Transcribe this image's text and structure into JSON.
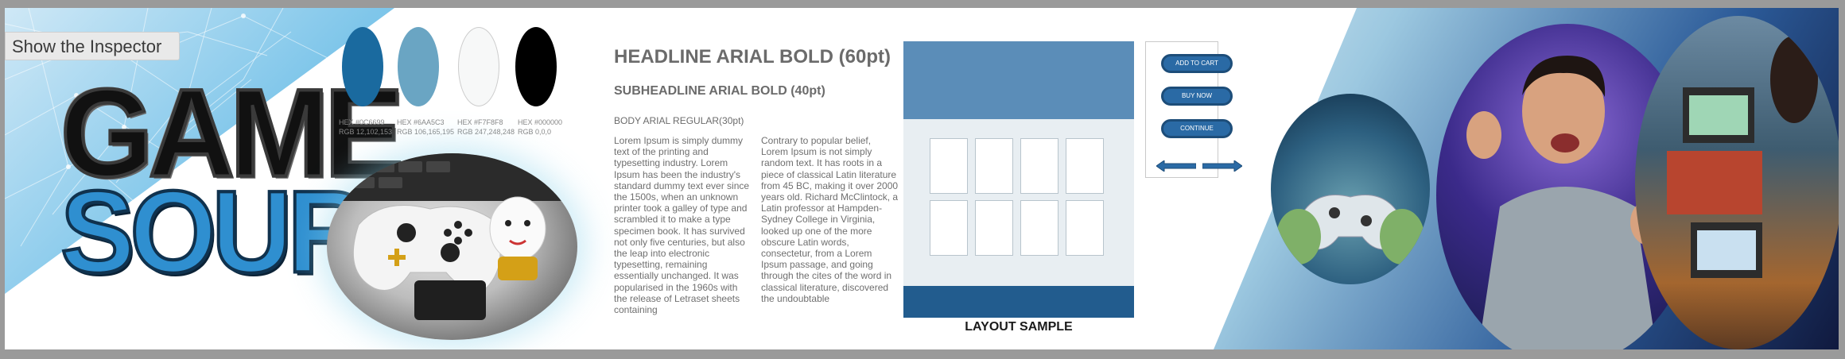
{
  "inspector": {
    "label": "Show the Inspector"
  },
  "logo": {
    "line1": "GAME",
    "line2": "SOURCE"
  },
  "swatches": [
    {
      "hex": "HEX #0C6699",
      "rgb": "RGB 12,102,153",
      "color": "#1a6a9f"
    },
    {
      "hex": "HEX #6AA5C3",
      "rgb": "RGB 106,165,195",
      "color": "#6aa5c3"
    },
    {
      "hex": "HEX #F7F8F8",
      "rgb": "RGB 247,248,248",
      "color": "#f7f8f8"
    },
    {
      "hex": "HEX #000000",
      "rgb": "RGB 0,0,0",
      "color": "#000000"
    }
  ],
  "typography": {
    "headline": "HEADLINE ARIAL BOLD (60pt)",
    "subheadline": "SUBHEADLINE ARIAL BOLD (40pt)",
    "body_title": "BODY ARIAL REGULAR(30pt)",
    "col1": "Lorem Ipsum is simply dummy text of the printing and typesetting industry. Lorem Ipsum has been the industry's standard dummy text ever since the 1500s, when an unknown printer took a galley of type and scrambled it to make a type specimen book. It has survived not only five centuries, but also the leap into electronic typesetting, remaining essentially unchanged. It was popularised in the 1960s with the release of Letraset sheets containing",
    "col2": "Contrary to popular belief, Lorem Ipsum is not simply random text. It has roots in a piece of classical Latin literature from 45 BC, making it over 2000 years old. Richard McClintock, a Latin professor at Hampden-Sydney College in Virginia, looked up one of the more obscure Latin words, consectetur, from a Lorem Ipsum passage, and going through the cites of the word in classical literature, discovered the undoubtable"
  },
  "layout_sample": {
    "caption": "LAYOUT SAMPLE"
  },
  "buttons": {
    "add_to_cart": "ADD TO CART",
    "buy_now": "BUY NOW",
    "continue": "CONTINUE"
  },
  "colors": {
    "primary": "#0C6699",
    "secondary": "#6AA5C3",
    "light": "#F7F8F8",
    "dark": "#000000"
  }
}
